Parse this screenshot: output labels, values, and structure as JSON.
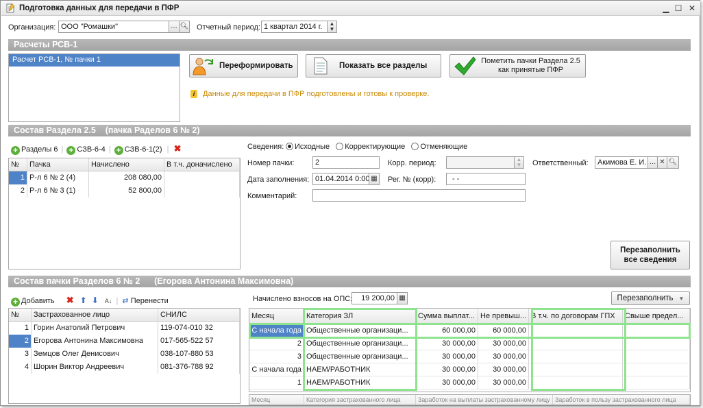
{
  "window": {
    "title": "Подготовка данных для передачи в ПФР"
  },
  "header": {
    "org_label": "Организация:",
    "org_value": "ООО \"Ромашки\"",
    "period_label": "Отчетный период:",
    "period_value": "1 квартал 2014 г."
  },
  "rsv": {
    "section_title": "Расчеты РСВ-1",
    "list": [
      "Расчет РСВ-1, № пачки 1"
    ],
    "reform_label": "Переформировать",
    "show_label": "Показать все разделы",
    "mark_label_1": "Пометить пачки Раздела 2.5",
    "mark_label_2": "как принятые ПФР",
    "info_text": "Данные для передачи в ПФР подготовлены и готовы к проверке."
  },
  "section25": {
    "title": "Состав Раздела 2.5    (пачка Раделов 6 № 2)",
    "tb_sections6": "Разделы 6",
    "tb_szv64": "СЗВ-6-4",
    "tb_szv612": "СЗВ-6-1(2)",
    "columns": [
      "№",
      "Пачка",
      "Начислено",
      "В т.ч. доначислено"
    ],
    "rows": [
      {
        "n": "1",
        "pack": "Р-л 6 № 2 (4)",
        "amount": "208 080,00",
        "extra": ""
      },
      {
        "n": "2",
        "pack": "Р-л 6 № 3 (1)",
        "amount": "52 800,00",
        "extra": ""
      }
    ],
    "svedeniya_label": "Сведения:",
    "radio_options": [
      "Исходные",
      "Корректирующие",
      "Отменяющие"
    ],
    "pack_num_label": "Номер пачки:",
    "pack_num_value": "2",
    "korr_period_label": "Корр. период:",
    "korr_period_value": "",
    "responsible_label": "Ответственный:",
    "responsible_value": "Акимова Е. И.",
    "date_label": "Дата заполнения:",
    "date_value": "01.04.2014 0:00",
    "reg_label": "Рег. № (корр):",
    "reg_value": "-  -",
    "comment_label": "Комментарий:",
    "comment_value": "",
    "refill_label_1": "Перезаполнить",
    "refill_label_2": "все сведения"
  },
  "pack6": {
    "title": "Состав пачки Разделов 6 № 2      (Егорова Антонина Максимовна)",
    "add_label": "Добавить",
    "transfer_label": "Перенести",
    "columns": [
      "№",
      "Застрахованное лицо",
      "СНИЛС"
    ],
    "persons": [
      {
        "n": "1",
        "name": "Горин Анатолий Петрович",
        "snils": "119-074-010 32"
      },
      {
        "n": "2",
        "name": "Егорова Антонина Максимовна",
        "snils": "017-565-522 57"
      },
      {
        "n": "3",
        "name": "Земцов Олег Денисович",
        "snils": "038-107-880 53"
      },
      {
        "n": "4",
        "name": "Шорин Виктор Андреевич",
        "snils": "081-376-788 92"
      }
    ],
    "ops_label": "Начислено взносов на ОПС:",
    "ops_value": "19 200,00",
    "refill_label": "Перезаполнить",
    "detail_columns": [
      "Месяц",
      "Категория ЗЛ",
      "Сумма выплат...",
      "Не превыш...",
      "В т.ч. по договорам ГПХ",
      "Свыше предел..."
    ],
    "detail_rows": [
      {
        "month": "С начала года",
        "cat": "Общественные организаци...",
        "sum": "60 000,00",
        "nonexc": "60 000,00",
        "gph": "",
        "over": ""
      },
      {
        "month": "2",
        "cat": "Общественные организаци...",
        "sum": "30 000,00",
        "nonexc": "30 000,00",
        "gph": "",
        "over": ""
      },
      {
        "month": "3",
        "cat": "Общественные организаци...",
        "sum": "30 000,00",
        "nonexc": "30 000,00",
        "gph": "",
        "over": ""
      },
      {
        "month": "С начала года",
        "cat": "НАЕМ/РАБОТНИК",
        "sum": "30 000,00",
        "nonexc": "30 000,00",
        "gph": "",
        "over": ""
      },
      {
        "month": "1",
        "cat": "НАЕМ/РАБОТНИК",
        "sum": "30 000,00",
        "nonexc": "30 000,00",
        "gph": "",
        "over": ""
      }
    ],
    "bottom_columns": [
      "Месяц",
      "Категория застрахованного лица",
      "Заработок на выплаты застрахованному лицу",
      "Заработок в пользу застрахованного лица"
    ]
  }
}
